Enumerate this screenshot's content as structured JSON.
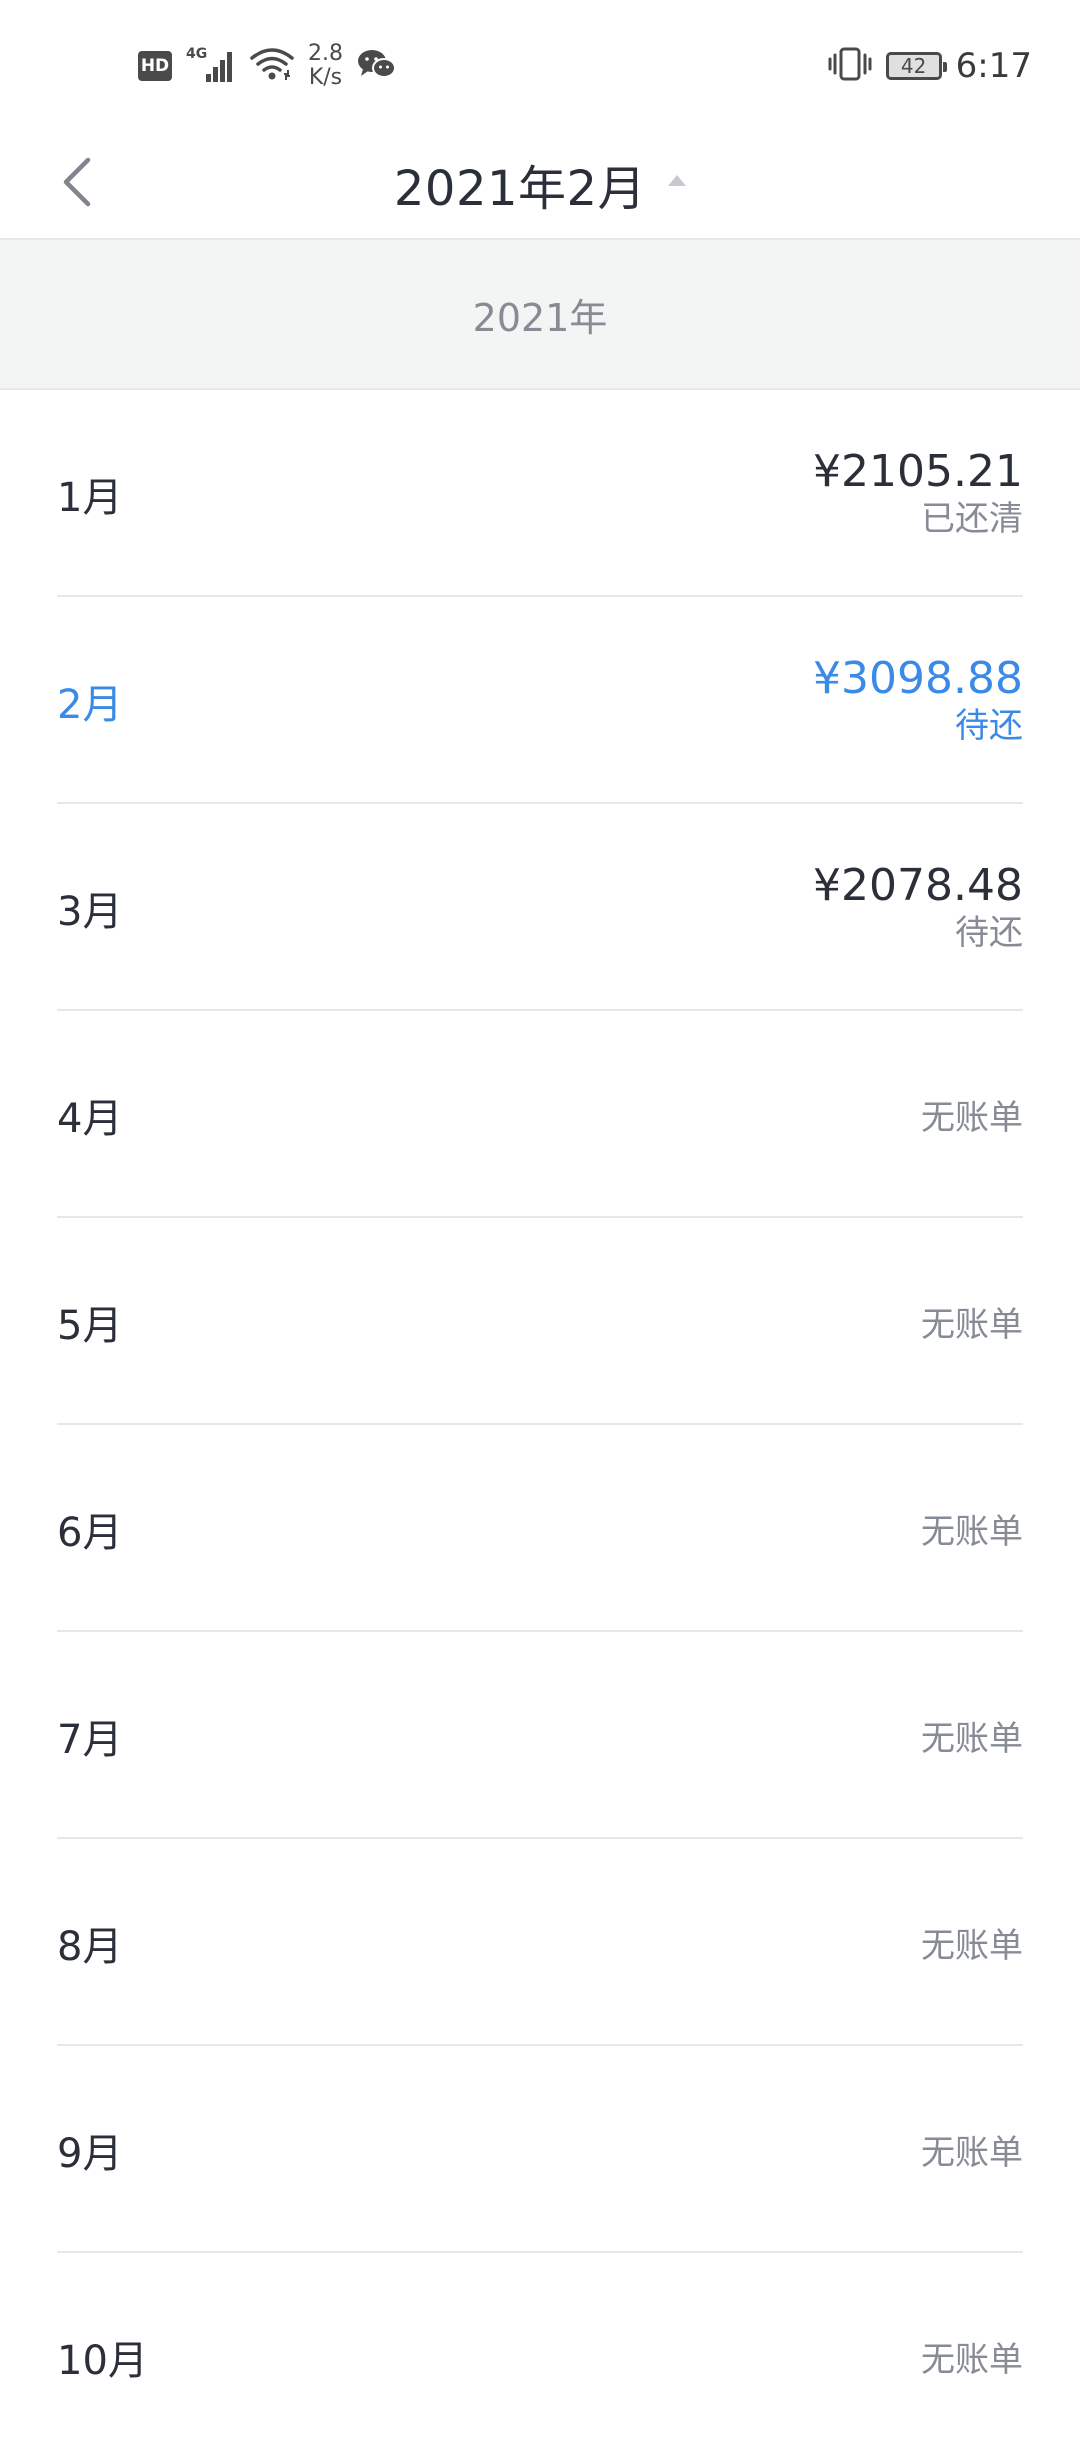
{
  "status_bar": {
    "hd_label": "HD",
    "network_label": "4G",
    "speed_value": "2.8",
    "speed_unit": "K/s",
    "battery_level": "42",
    "time": "6:17",
    "icons": [
      "hd-icon",
      "signal-icon",
      "wifi-icon",
      "wechat-icon",
      "vibrate-icon",
      "battery-icon"
    ]
  },
  "header": {
    "title": "2021年2月",
    "back_icon": "chevron-left-icon",
    "dropdown_icon": "caret-up-icon"
  },
  "year_section": {
    "label": "2021年"
  },
  "colors": {
    "accent": "#3c8ae8",
    "text_primary": "#2b2f3a",
    "text_secondary": "#868b95",
    "section_bg": "#f3f4f4"
  },
  "months": [
    {
      "label": "1月",
      "amount": "¥2105.21",
      "status": "已还清"
    },
    {
      "label": "2月",
      "amount": "¥3098.88",
      "status": "待还",
      "selected": true
    },
    {
      "label": "3月",
      "amount": "¥2078.48",
      "status": "待还"
    },
    {
      "label": "4月",
      "no_bill": "无账单"
    },
    {
      "label": "5月",
      "no_bill": "无账单"
    },
    {
      "label": "6月",
      "no_bill": "无账单"
    },
    {
      "label": "7月",
      "no_bill": "无账单"
    },
    {
      "label": "8月",
      "no_bill": "无账单"
    },
    {
      "label": "9月",
      "no_bill": "无账单"
    },
    {
      "label": "10月",
      "no_bill": "无账单"
    }
  ]
}
